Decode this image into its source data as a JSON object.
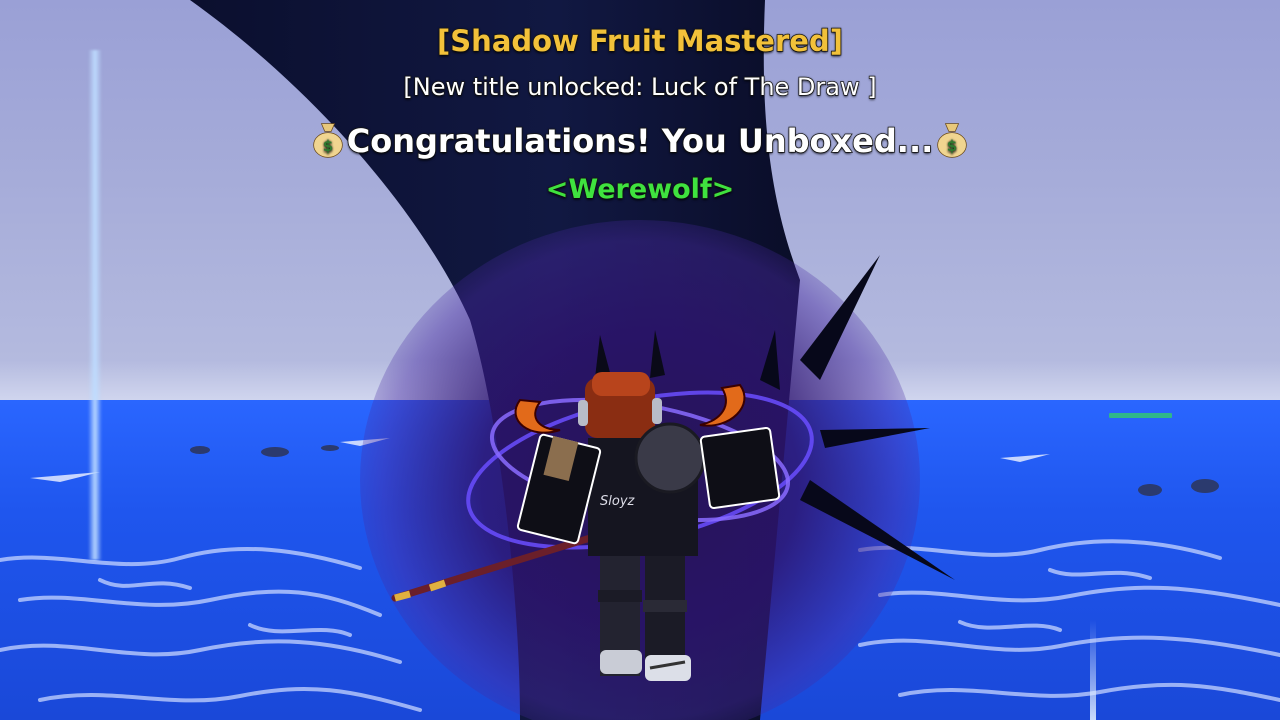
{
  "hud": {
    "mastery_message": "[Shadow Fruit Mastered]",
    "title_message": "[New title unlocked: Luck of The Draw ]",
    "congrats_message": "Congratulations! You Unboxed...",
    "unboxed_item": "<Werewolf>"
  },
  "icons": {
    "left_emoji": "money-bag-icon",
    "right_emoji": "money-bag-icon"
  },
  "colors": {
    "mastery": "#f2c13a",
    "title": "#ffffff",
    "congrats": "#ffffff",
    "unboxed": "#3fe23f",
    "sea": "#1f56ee",
    "sky": "#9aa0d6",
    "shadow_aura": "#2d146e"
  }
}
